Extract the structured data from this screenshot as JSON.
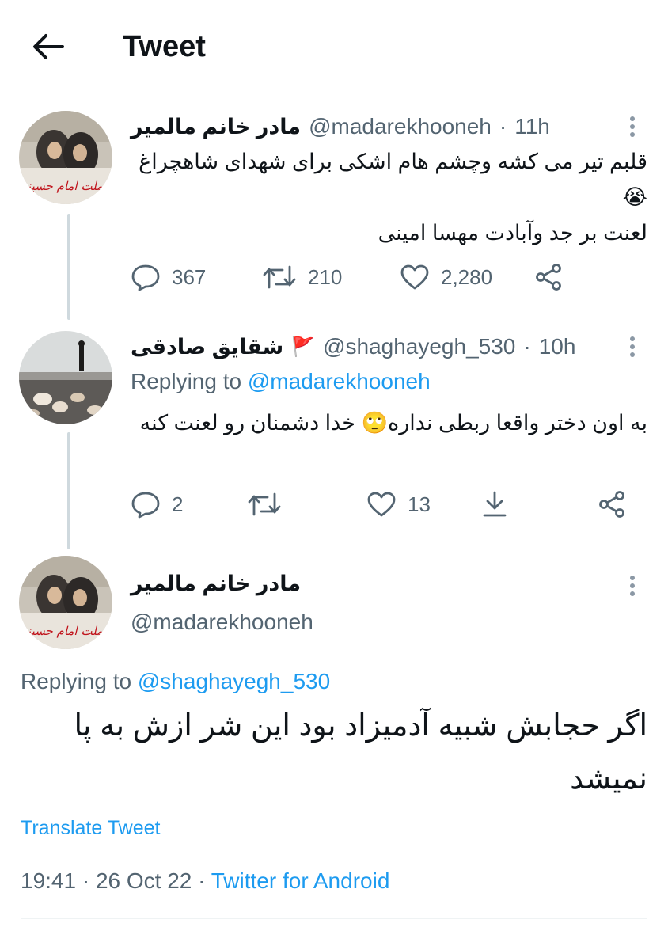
{
  "header": {
    "title": "Tweet",
    "back_icon": "arrow-left-icon"
  },
  "tweet1": {
    "display_name": "مادر خانم مالمیر",
    "handle": "@madarekhooneh",
    "time": "11h",
    "text_line1": "قلبم تیر می کشه وچشم هام اشکی برای شهدای شاهچراغ",
    "emoji": "😭",
    "text_line2": "لعنت بر جد وآبادت مهسا امینی",
    "replies": "367",
    "retweets": "210",
    "likes": "2,280"
  },
  "tweet2": {
    "display_name": "شقایق صادقی",
    "flag_emoji": "🚩",
    "handle": "@shaghayegh_530",
    "time": "10h",
    "replying_label": "Replying to",
    "replying_handle": "@madarekhooneh",
    "text": "به اون دختر واقعا ربطی نداره🙄 خدا دشمنان رو لعنت کنه",
    "replies": "2",
    "likes": "13"
  },
  "focus": {
    "display_name": "مادر خانم مالمیر",
    "handle": "@madarekhooneh",
    "replying_label": "Replying to",
    "replying_handle": "@shaghayegh_530",
    "text": "اگر حجابش شبیه آدمیزاد بود این شر ازش به پا نمیشد",
    "translate": "Translate Tweet",
    "timestamp": "19:41 · 26 Oct 22 · ",
    "source": "Twitter for Android"
  },
  "avatar1": {
    "caption": "ما ملت امام حسینیم"
  },
  "colors": {
    "accent": "#1d9bf0",
    "muted": "#536471",
    "text": "#0f1419",
    "line": "#cfd9de"
  }
}
